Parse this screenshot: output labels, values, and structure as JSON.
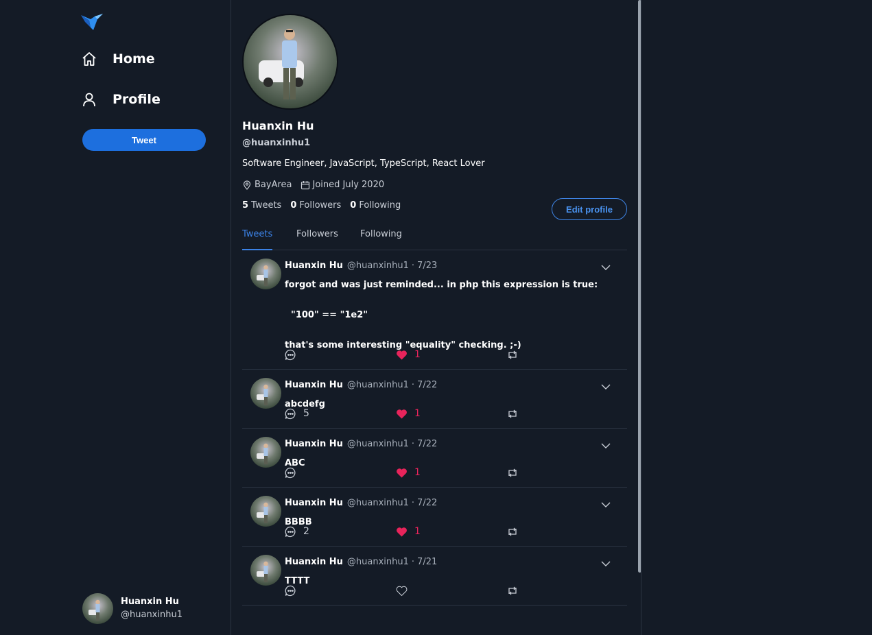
{
  "colors": {
    "background": "#141b26",
    "accent": "#1d6fde",
    "like": "#e8245b",
    "divider": "#2b3442",
    "muted": "#a8b0bb"
  },
  "sidebar": {
    "logo_icon": "bird-logo-icon",
    "nav": [
      {
        "label": "Home",
        "icon": "home-icon"
      },
      {
        "label": "Profile",
        "icon": "user-icon"
      }
    ],
    "tweet_button": "Tweet",
    "account": {
      "name": "Huanxin Hu",
      "handle": "@huanxinhu1"
    }
  },
  "profile": {
    "name": "Huanxin Hu",
    "handle": "@huanxinhu1",
    "bio": "Software Engineer, JavaScript, TypeScript, React Lover",
    "location": "BayArea",
    "joined": "Joined July 2020",
    "stats": {
      "tweets_count": "5",
      "tweets_label": "Tweets",
      "followers_count": "0",
      "followers_label": "Followers",
      "following_count": "0",
      "following_label": "Following"
    },
    "edit_button": "Edit profile"
  },
  "tabs": [
    {
      "label": "Tweets",
      "active": true
    },
    {
      "label": "Followers",
      "active": false
    },
    {
      "label": "Following",
      "active": false
    }
  ],
  "tweets": [
    {
      "name": "Huanxin Hu",
      "handle": "@huanxinhu1",
      "separator": "·",
      "date": "7/23",
      "lines": [
        "forgot and was just reminded... in php this expression is true:",
        "",
        "  \"100\" == \"1e2\"",
        "",
        "that's some interesting \"equality\" checking. ;-)"
      ],
      "replies": "",
      "likes": "1"
    },
    {
      "name": "Huanxin Hu",
      "handle": "@huanxinhu1",
      "separator": "·",
      "date": "7/22",
      "lines": [
        "abcdefg"
      ],
      "replies": "5",
      "likes": "1"
    },
    {
      "name": "Huanxin Hu",
      "handle": "@huanxinhu1",
      "separator": "·",
      "date": "7/22",
      "lines": [
        "ABC"
      ],
      "replies": "",
      "likes": "1"
    },
    {
      "name": "Huanxin Hu",
      "handle": "@huanxinhu1",
      "separator": "·",
      "date": "7/22",
      "lines": [
        "BBBB"
      ],
      "replies": "2",
      "likes": "1"
    },
    {
      "name": "Huanxin Hu",
      "handle": "@huanxinhu1",
      "separator": "·",
      "date": "7/21",
      "lines": [
        "TTTT"
      ],
      "replies": "",
      "likes": ""
    }
  ]
}
